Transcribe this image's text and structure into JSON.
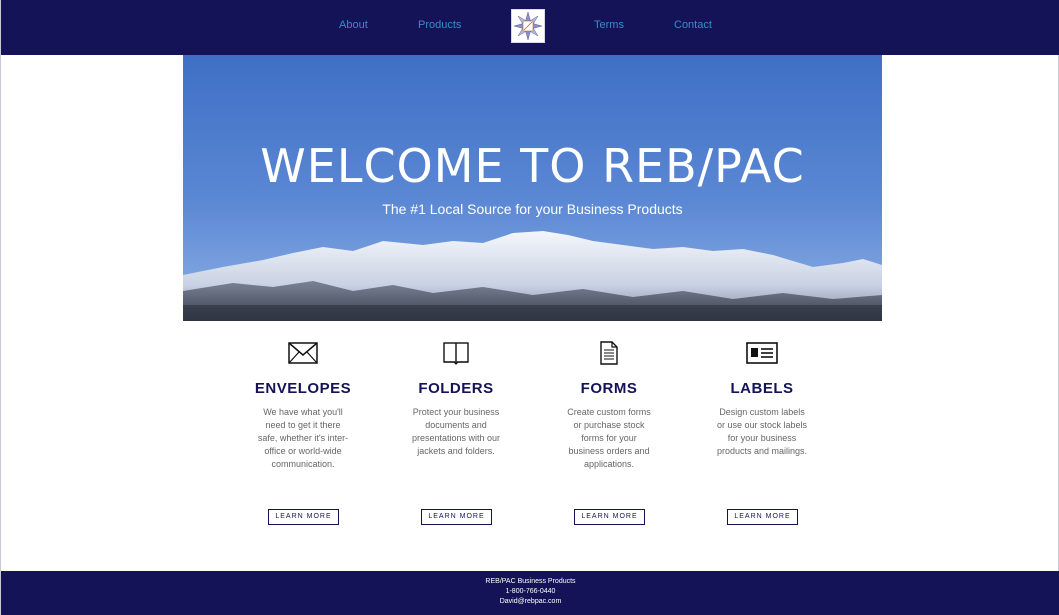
{
  "nav": {
    "about": "About",
    "products": "Products",
    "terms": "Terms",
    "contact": "Contact",
    "logo_icon": "rebpac-star-logo-icon"
  },
  "hero": {
    "title": "WELCOME TO REB/PAC",
    "subtitle": "The #1 Local Source for your Business Products"
  },
  "cards": [
    {
      "icon": "envelope-icon",
      "title": "ENVELOPES",
      "text": "We have what you'll need to get it there safe, whether it's inter-office or world-wide communication.",
      "button": "LEARN MORE"
    },
    {
      "icon": "book-icon",
      "title": "FOLDERS",
      "text": "Protect your business documents and presentations with our jackets and folders.",
      "button": "LEARN MORE"
    },
    {
      "icon": "document-icon",
      "title": "FORMS",
      "text": "Create custom forms or purchase stock forms for your business orders and applications.",
      "button": "LEARN MORE"
    },
    {
      "icon": "label-card-icon",
      "title": "LABELS",
      "text": "Design custom labels or use our stock labels for your business products and mailings.",
      "button": "LEARN MORE"
    }
  ],
  "footer": {
    "company": "REB/PAC Business Products",
    "phone": "1-800-766-0440",
    "email": "David@rebpac.com"
  },
  "colors": {
    "navy": "#141357",
    "link": "#3a8bc9"
  }
}
